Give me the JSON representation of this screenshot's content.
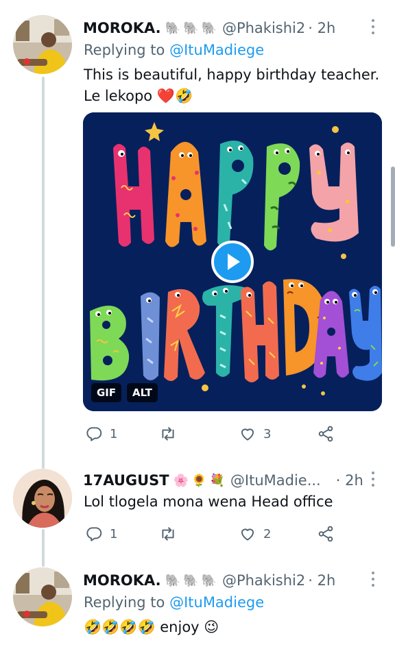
{
  "tweets": [
    {
      "name": "MOROKA.",
      "name_emoji": [
        "🐘",
        "🐘",
        "🐘"
      ],
      "handle": "@Phakishi2",
      "time": "· 2h",
      "reply_prefix": "Replying to ",
      "reply_handle": "@ItuMadiege",
      "text_line1": "This is beautiful,  happy birthday teacher.",
      "text_line2": "Le lekopo ❤️🤣",
      "media": {
        "gif_label": "GIF",
        "alt_label": "ALT",
        "letters_row1": [
          "H",
          "A",
          "P",
          "P",
          "Y"
        ],
        "letters_row2": [
          "B",
          "I",
          "R",
          "T",
          "H",
          "D",
          "A",
          "Y"
        ]
      },
      "replies": "1",
      "retweets": "",
      "likes": "3"
    },
    {
      "name": "17AUGUST",
      "name_emoji": [
        "🌸",
        "🌻",
        "💐"
      ],
      "handle": "@ItuMadie...",
      "time": "· 2h",
      "text_line1": "Lol tlogela mona wena Head office",
      "replies": "1",
      "retweets": "",
      "likes": "2"
    },
    {
      "name": "MOROKA.",
      "name_emoji": [
        "🐘",
        "🐘",
        "🐘"
      ],
      "handle": "@Phakishi2",
      "time": "· 2h",
      "reply_prefix": "Replying to ",
      "reply_handle": "@ItuMadiege",
      "text_line1": "🤣🤣🤣🤣 enjoy 😉"
    }
  ],
  "icons": {
    "reply": "comment-icon",
    "retweet": "retweet-icon",
    "like": "heart-icon",
    "share": "share-icon",
    "more": "more-vertical-icon",
    "play": "play-icon"
  },
  "colors": {
    "link": "#1d9bf0",
    "secondary": "#536471",
    "media_bg": "#06205c"
  }
}
